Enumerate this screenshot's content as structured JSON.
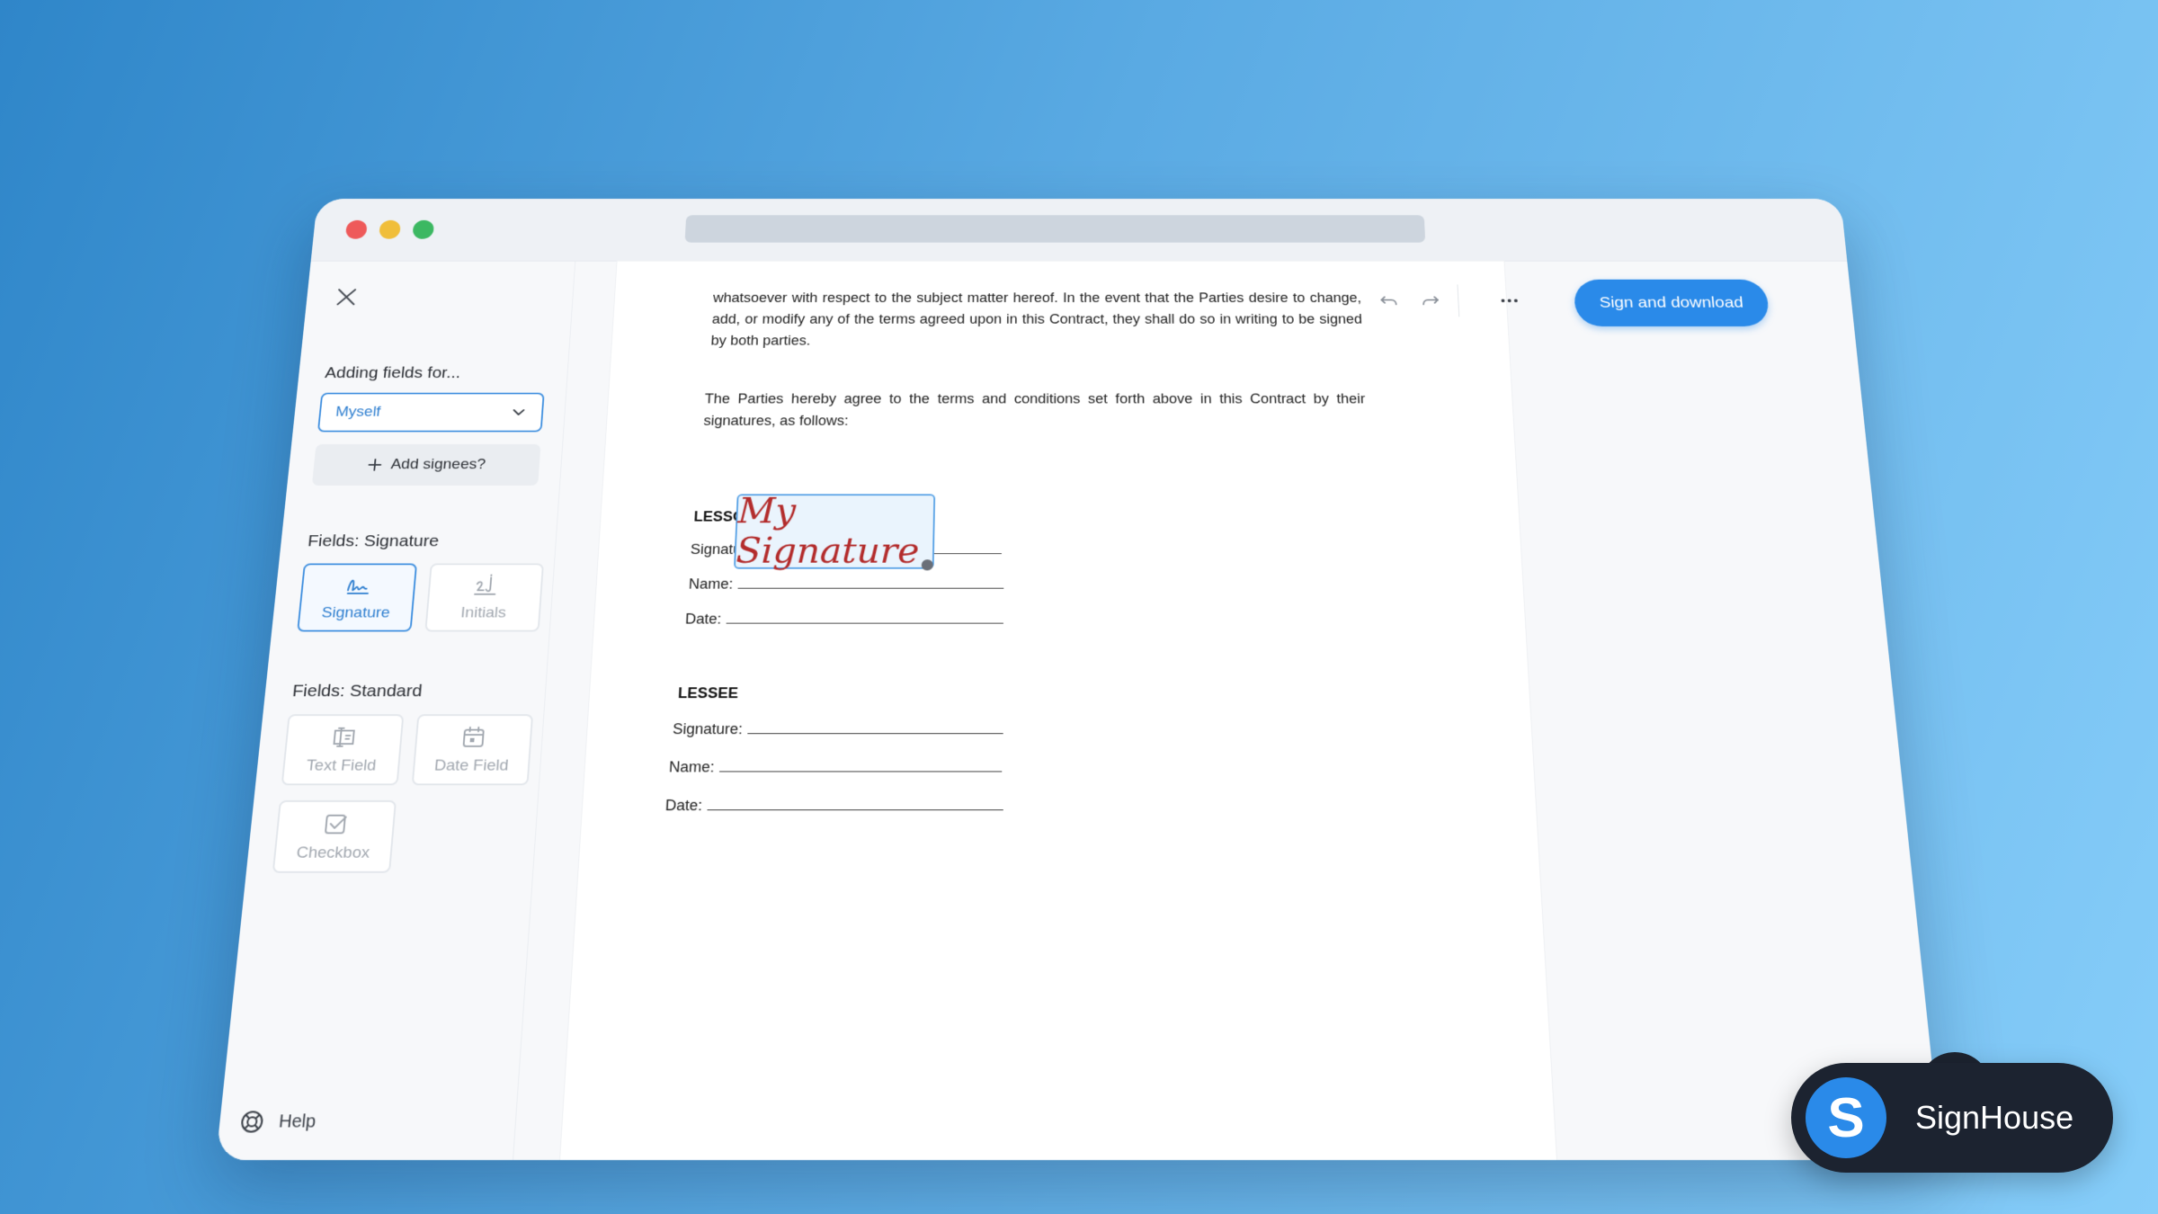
{
  "sidebar": {
    "adding_fields_label": "Adding fields for...",
    "signer_select_value": "Myself",
    "add_signees_label": "Add signees?",
    "signature_section_label": "Fields: Signature",
    "signature_tiles": [
      {
        "label": "Signature",
        "icon": "signature-icon",
        "active": true
      },
      {
        "label": "Initials",
        "icon": "initials-icon",
        "active": false
      }
    ],
    "standard_section_label": "Fields: Standard",
    "standard_tiles": [
      {
        "label": "Text Field",
        "icon": "text-field-icon"
      },
      {
        "label": "Date Field",
        "icon": "calendar-icon"
      },
      {
        "label": "Checkbox",
        "icon": "checkbox-icon"
      }
    ],
    "help_label": "Help"
  },
  "toolbar": {
    "sign_download_label": "Sign and download",
    "more_icon": "more-horizontal-icon",
    "undo_icon": "undo-icon",
    "redo_icon": "redo-icon"
  },
  "document": {
    "para1": "whatsoever with respect to the subject matter hereof. In the event that the Parties desire to change, add, or modify any of the terms agreed upon in this Contract, they shall do so in writing to be signed by both parties.",
    "para2": "The Parties hereby agree to the terms and conditions set forth above in this Contract by their signatures, as follows:",
    "lessor": {
      "heading": "LESSOR",
      "signature_label": "Signature:",
      "name_label": "Name:",
      "date_label": "Date:",
      "signature_value": "My Signature"
    },
    "lessee": {
      "heading": "LESSEE",
      "signature_label": "Signature:",
      "name_label": "Name:",
      "date_label": "Date:"
    }
  },
  "brand": {
    "logo_letter": "S",
    "name": "SignHouse",
    "accent": "#2a8ae9"
  }
}
